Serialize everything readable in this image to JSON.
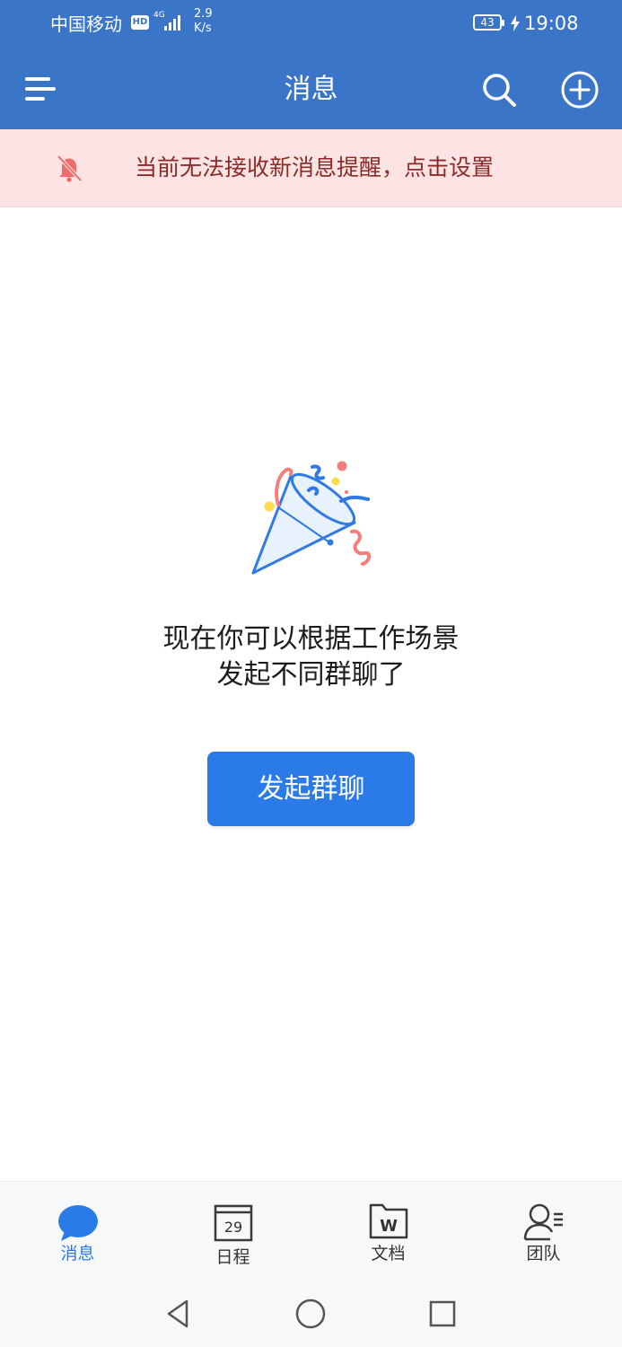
{
  "status_bar": {
    "carrier": "中国移动",
    "hd_badge": "HD",
    "network_type": "4G",
    "net_speed_value": "2.9",
    "net_speed_unit": "K/s",
    "battery": "43",
    "time": "19:08"
  },
  "app_bar": {
    "title": "消息",
    "menu_icon": "menu-icon",
    "search_icon": "search-icon",
    "add_icon": "plus-circle-icon"
  },
  "notice": {
    "icon": "bell-off-icon",
    "text": "当前无法接收新消息提醒，点击设置"
  },
  "empty_state": {
    "illustration": "party-popper-icon",
    "line1": "现在你可以根据工作场景",
    "line2": "发起不同群聊了",
    "button_label": "发起群聊"
  },
  "tabs": [
    {
      "label": "消息",
      "icon": "chat-bubble-icon",
      "active": true
    },
    {
      "label": "日程",
      "icon": "calendar-icon",
      "day": "29",
      "active": false
    },
    {
      "label": "文档",
      "icon": "document-folder-icon",
      "letter": "W",
      "active": false
    },
    {
      "label": "团队",
      "icon": "team-contact-icon",
      "active": false
    }
  ],
  "colors": {
    "primary": "#3a75c8",
    "accent": "#2a7be8",
    "notice_bg": "#fde3e4",
    "notice_text": "#8b2b27",
    "alert_icon": "#f26b6b"
  }
}
